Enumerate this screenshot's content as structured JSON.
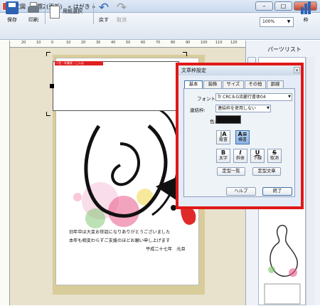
{
  "window": {
    "title": "文図　無題2(更新)　« はがき »",
    "min_label": "–",
    "max_label": "□",
    "close_label": "×"
  },
  "toolbar": {
    "save_label": "保存",
    "print_label": "印刷",
    "paper_select_label": "用紙選択",
    "undo_label": "戻す",
    "redo_label": "取消",
    "frame_label": "枠",
    "zoom_value": "100%",
    "zoom_arrow": "▼"
  },
  "ruler": {
    "marks": [
      "20",
      "10",
      "0",
      "10",
      "20",
      "30",
      "40",
      "50",
      "60",
      "70",
      "80",
      "90",
      "100",
      "110",
      "120"
    ]
  },
  "postcard": {
    "strip_text": "一言・年賀状・こんな",
    "greeting_lines": [
      "旧年中は大変お世話になりありがとうございました",
      "本年も相変わらずご支援のほどお願い申し上げます"
    ],
    "signature": "平成二十七年　元旦"
  },
  "parts_panel": {
    "title": "パーツリスト"
  },
  "dialog": {
    "title": "文章枠設定",
    "close_label": "×",
    "tabs": [
      "基本",
      "装飾",
      "サイズ",
      "その他",
      "罫線"
    ],
    "font_label": "フォント:",
    "font_value": "Tr CRC＆G流麗行書体04",
    "linking_label": "連結枠:",
    "linking_value": "連結枠を使用しない",
    "color_label": "色:",
    "color_value": "#111111",
    "vertical_label": "縦書",
    "vertical_glyph": "|A",
    "horizontal_label": "横書",
    "horizontal_glyph": "A≡",
    "bold_label": "太字",
    "bold_glyph": "B",
    "italic_label": "斜体",
    "italic_glyph": "I",
    "underline_label": "下線",
    "underline_glyph": "U",
    "cancel_label": "取消",
    "cancel_glyph": "S",
    "template_list_label": "定型一覧",
    "template_text_label": "定型文章",
    "help_label": "ヘルプ",
    "ok_label": "終了"
  }
}
